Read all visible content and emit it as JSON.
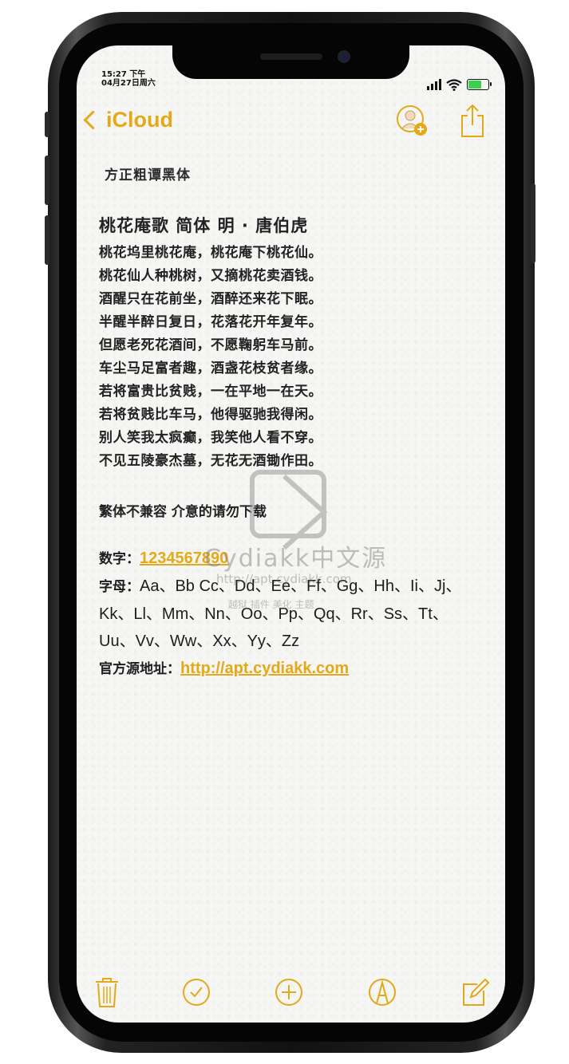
{
  "status": {
    "time": "15:27 下午",
    "date": "04月27日周六"
  },
  "nav": {
    "back_label": "iCloud"
  },
  "note": {
    "header": "方正粗谭黑体",
    "poem_title": "桃花庵歌  简体  明 · 唐伯虎",
    "poem_lines": [
      "桃花坞里桃花庵，桃花庵下桃花仙。",
      "桃花仙人种桃树，又摘桃花卖酒钱。",
      "酒醒只在花前坐，酒醉还来花下眠。",
      "半醒半醉日复日，花落花开年复年。",
      "但愿老死花酒间，不愿鞠躬车马前。",
      "车尘马足富者趣，酒盏花枝贫者缘。",
      "若将富贵比贫贱，一在平地一在天。",
      "若将贫贱比车马，他得驱驰我得闲。",
      "别人笑我太疯癫，我笑他人看不穿。",
      "不见五陵豪杰墓，无花无酒锄作田。"
    ],
    "compat_note": "繁体不兼容 介意的请勿下载",
    "digits_label": "数字：",
    "digits_value": "1234567890",
    "letters_label": "字母：",
    "letters_value": "Aa、Bb Cc、Dd、Ee、Ff、Gg、Hh、Ii、Jj、Kk、Ll、Mm、Nn、Oo、Pp、Qq、Rr、Ss、Tt、Uu、Vv、Ww、Xx、Yy、Zz",
    "source_label": "官方源地址：",
    "source_url": "http://apt.cydiakk.com"
  },
  "watermark": {
    "line1": "Cydiakk中文源",
    "line2": "http://apt.cydiakk.com",
    "line3": "越狱 插件 美化 主题"
  },
  "icons": {
    "trash": "trash-icon",
    "check": "checklist-icon",
    "add": "add-icon",
    "markup": "markup-pen-icon",
    "compose": "compose-icon",
    "share_user": "add-person-icon",
    "upload": "share-icon"
  },
  "colors": {
    "accent": "#e3a917",
    "text": "#1d1d1d",
    "paper": "#f6f6f4"
  }
}
